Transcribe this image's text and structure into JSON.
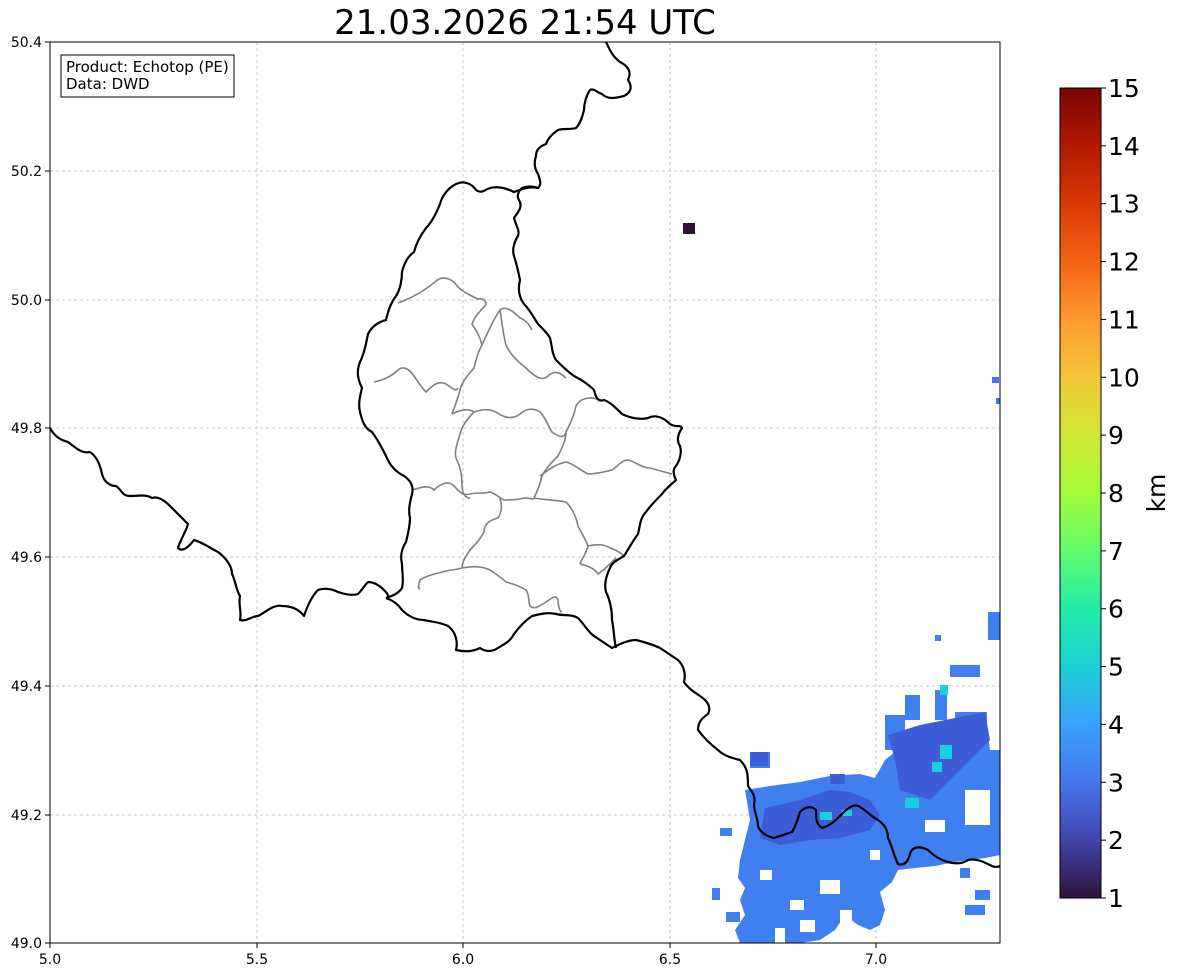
{
  "title": "21.03.2026 21:54 UTC",
  "info": {
    "product_line": "Product: Echotop (PE)",
    "data_line": "Data: DWD"
  },
  "map": {
    "lon_range": [
      5.0,
      7.3
    ],
    "lat_range": [
      49.0,
      50.4
    ],
    "x_ticks": [
      "5.0",
      "5.5",
      "6.0",
      "6.5",
      "7.0"
    ],
    "y_ticks": [
      "49.0",
      "49.2",
      "49.4",
      "49.6",
      "49.8",
      "50.0",
      "50.2",
      "50.4"
    ],
    "gridlines": true,
    "national_border_color": "#000000",
    "canton_border_color": "#808080"
  },
  "colorbar": {
    "label": "km",
    "min": 1,
    "max": 15,
    "ticks": [
      "1",
      "2",
      "3",
      "4",
      "5",
      "6",
      "7",
      "8",
      "9",
      "10",
      "11",
      "12",
      "13",
      "14",
      "15"
    ],
    "colormap": "turbo",
    "stops": [
      "#30123b",
      "#4145ab",
      "#4675ed",
      "#39a2fc",
      "#1bcfd4",
      "#24eca6",
      "#61fc6c",
      "#a4fc3b",
      "#d1e834",
      "#f3c63a",
      "#fe9b2d",
      "#f36315",
      "#d93806",
      "#b11901",
      "#7a0402"
    ]
  },
  "echo_values_km": {
    "isolated_pixel_northeast": 1.2,
    "main_cell_southeast": 3.0,
    "core_pixels": 5.0
  }
}
